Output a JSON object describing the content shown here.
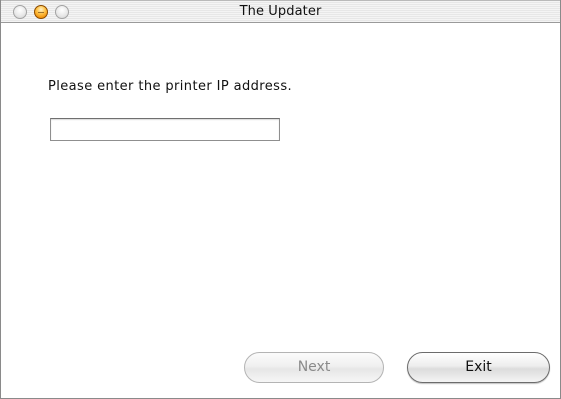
{
  "window": {
    "title": "The Updater"
  },
  "content": {
    "prompt": "Please enter the printer IP address.",
    "ip_field": {
      "value": "",
      "placeholder": ""
    }
  },
  "buttons": {
    "next_label": "Next",
    "exit_label": "Exit"
  },
  "colors": {
    "minimize_button": "#f08a00",
    "disabled_text": "#8a8a8a"
  }
}
